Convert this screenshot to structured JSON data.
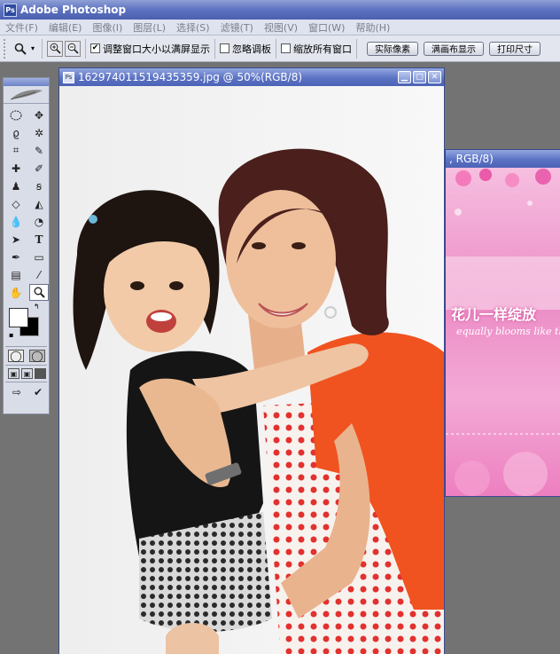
{
  "app": {
    "title": "Adobe Photoshop",
    "logo_text": "Ps"
  },
  "menu": [
    "文件(F)",
    "编辑(E)",
    "图像(I)",
    "图层(L)",
    "选择(S)",
    "滤镜(T)",
    "视图(V)",
    "窗口(W)",
    "帮助(H)"
  ],
  "options": {
    "tool_icon": "zoom-icon",
    "resize_window_label": "调整窗口大小以满屏显示",
    "resize_window_checked": true,
    "ignore_palettes_label": "忽略调板",
    "ignore_palettes_checked": false,
    "zoom_all_label": "缩放所有窗口",
    "zoom_all_checked": false,
    "actual_pixels_label": "实际像素",
    "fit_screen_label": "满画布显示",
    "print_size_label": "打印尺寸"
  },
  "document_main": {
    "title": "162974011519435359.jpg @ 50%(RGB/8)"
  },
  "document_back": {
    "title": ", RGB/8)",
    "text_main": "花儿一样绽放",
    "text_sub": "equally blooms like the"
  },
  "colors": {
    "title_blue": "#5d72c0",
    "menu_bg": "#dfe3ef",
    "orange_shirt": "#f0531f",
    "pink": "#ec8cc6"
  }
}
